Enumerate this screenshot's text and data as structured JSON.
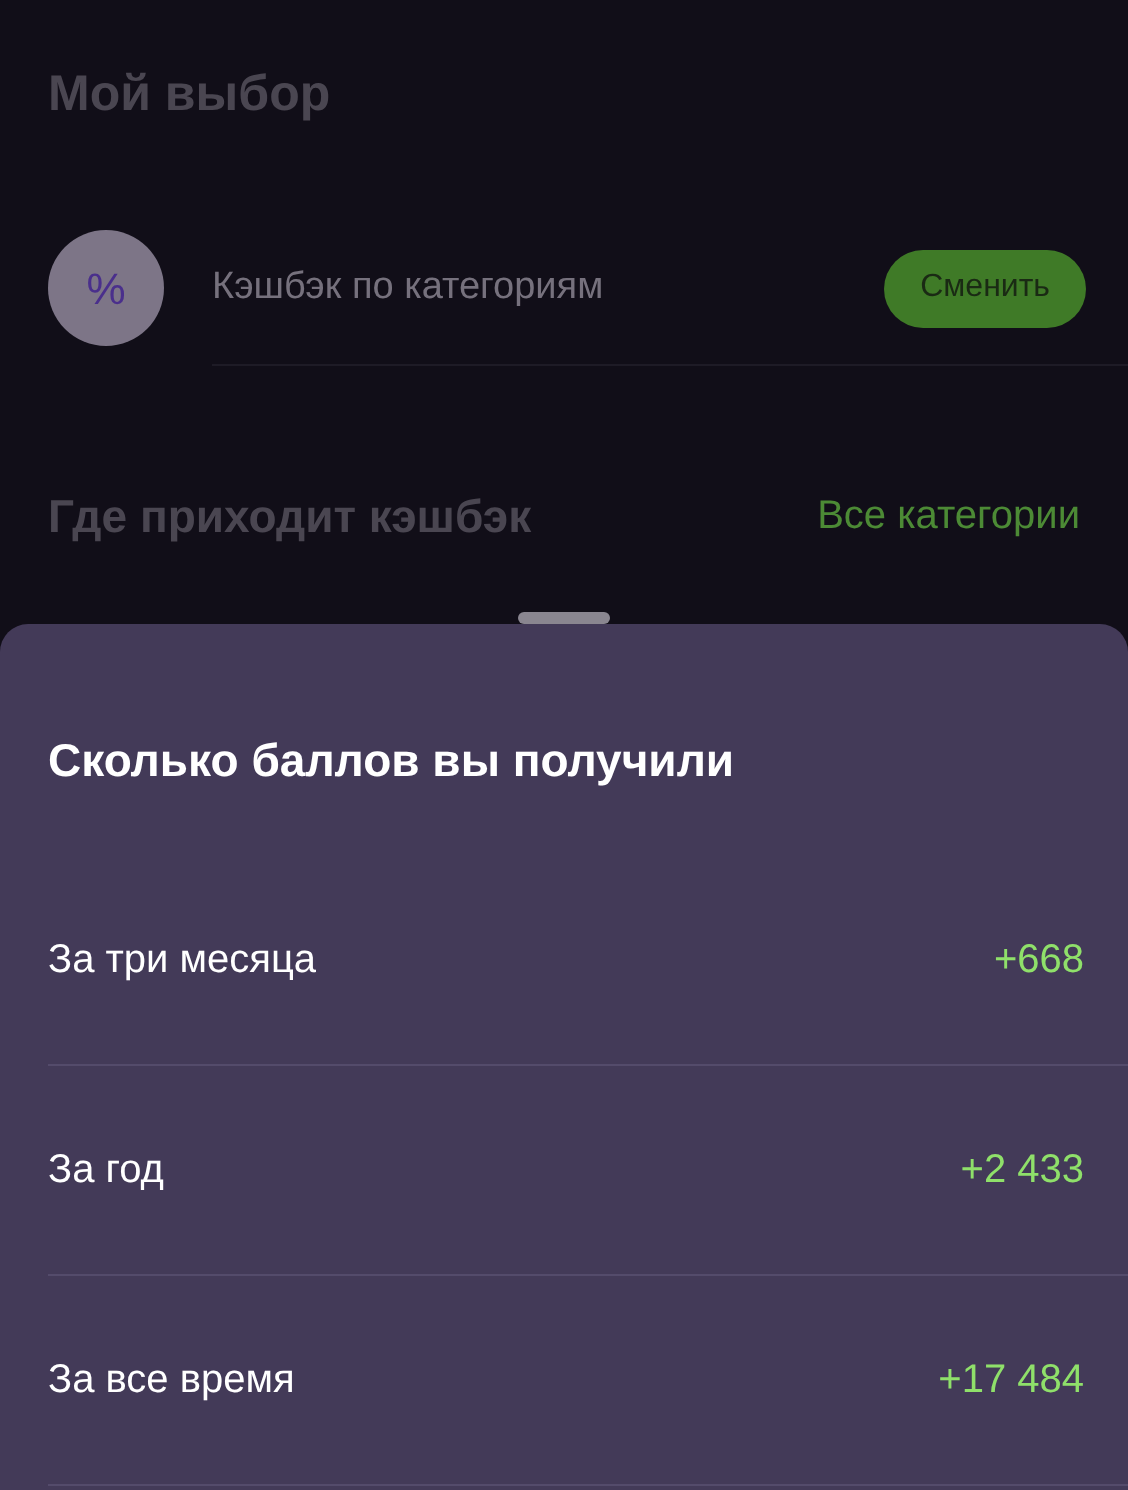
{
  "background": {
    "title": "Мой выбор",
    "option": {
      "icon_glyph": "%",
      "label": "Кэшбэк по категориям",
      "button": "Сменить"
    },
    "section": {
      "title": "Где приходит кэшбэк",
      "link": "Все категории"
    }
  },
  "sheet": {
    "title": "Сколько баллов вы получили",
    "rows": [
      {
        "label": "За три месяца",
        "value": "+668"
      },
      {
        "label": "За год",
        "value": "+2 433"
      },
      {
        "label": "За все время",
        "value": "+17 484"
      }
    ]
  }
}
